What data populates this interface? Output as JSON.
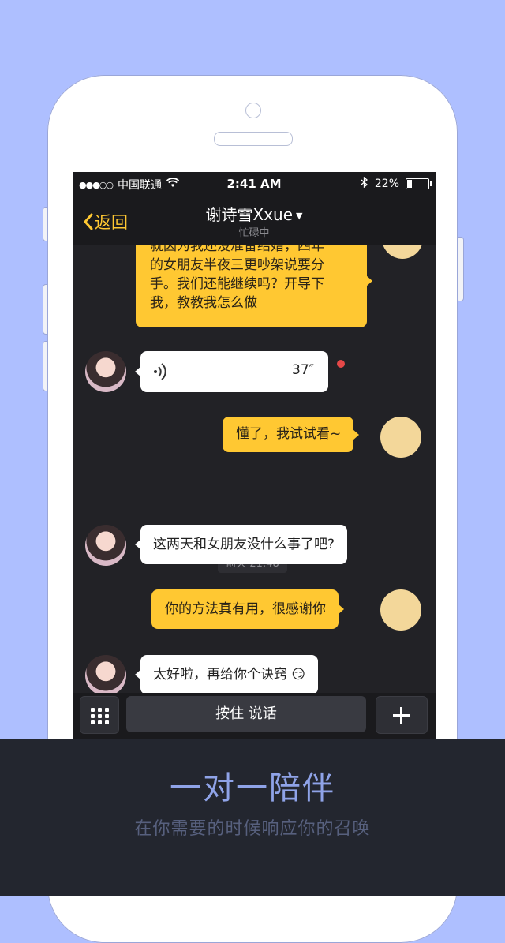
{
  "status_bar": {
    "signal": "●●●○○",
    "carrier": "中国联通",
    "wifi_icon": "wifi-icon",
    "time": "2:41 AM",
    "bluetooth_icon": "bluetooth-icon",
    "battery_percent": "22%",
    "battery_level": 0.22
  },
  "nav": {
    "back_label": "返回",
    "title": "谢诗雪Xxue",
    "subtitle": "忙碌中"
  },
  "messages": {
    "m1": {
      "lines": [
        "就因为我还没准备结婚，四年",
        "的女朋友半夜三更吵架说要分",
        "手。我们还能继续吗？开导下",
        "我，教教我怎么做"
      ]
    },
    "m2": {
      "duration": "37″"
    },
    "m3": {
      "text": "懂了，我试试看~"
    },
    "timestamp": "前天 21:48",
    "m4": {
      "text": "这两天和女朋友没什么事了吧?"
    },
    "m5": {
      "text": "你的方法真有用，很感谢你"
    },
    "m6": {
      "text": "太好啦，再给你个诀窍",
      "emoji": "😏"
    }
  },
  "input_bar": {
    "talk_label": "按住 说话",
    "keyboard_icon": "keypad-icon",
    "plus_icon": "plus-icon"
  },
  "promo": {
    "headline": "一对一陪伴",
    "subline": "在你需要的时候响应你的召唤"
  },
  "colors": {
    "background": "#aebfff",
    "accent": "#ffc832",
    "chat_bg": "#222226",
    "promo_bg": "#23262f",
    "headline": "#8fa3e8"
  }
}
